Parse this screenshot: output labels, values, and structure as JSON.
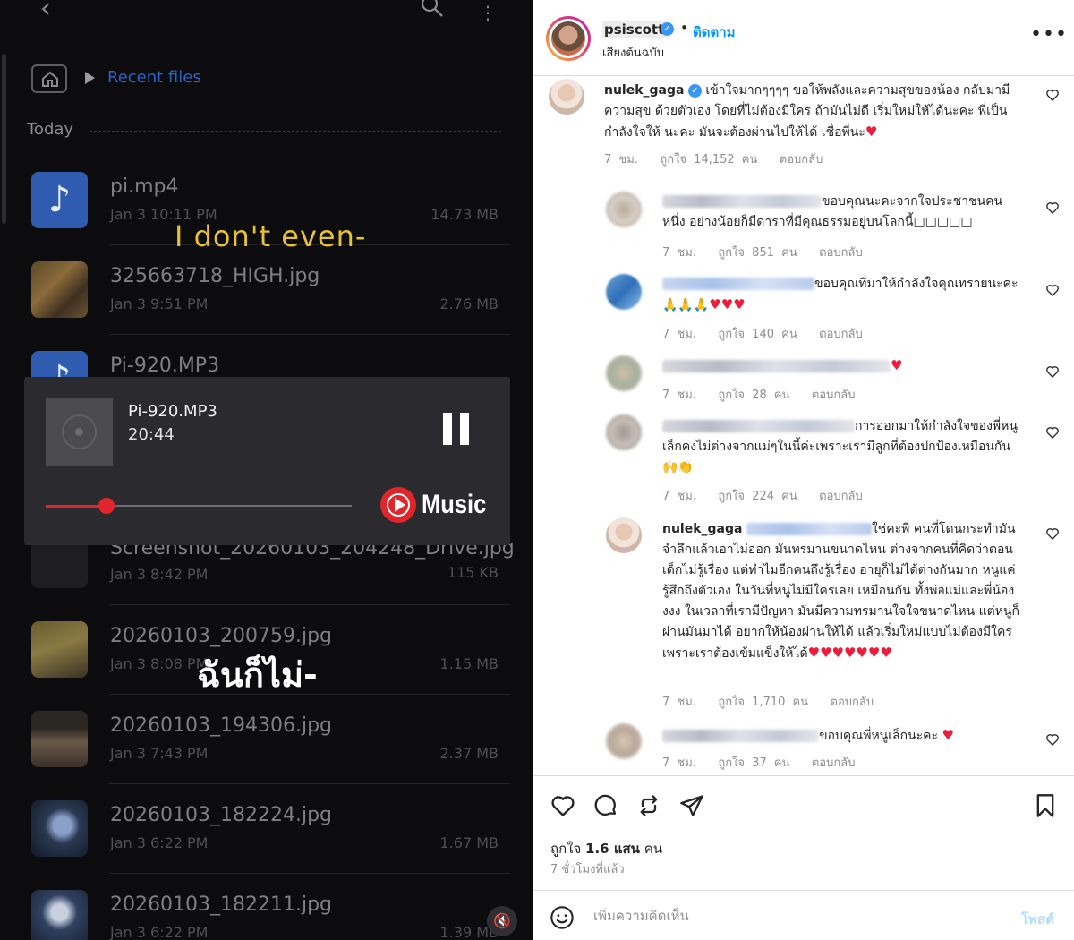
{
  "file_manager": {
    "breadcrumb": "Recent files",
    "section_label": "Today",
    "files": [
      {
        "name": "pi.mp4",
        "date": "Jan 3 10:11 PM",
        "size": "14.73 MB",
        "thumb": "music"
      },
      {
        "name": "325663718_HIGH.jpg",
        "date": "Jan 3 9:51 PM",
        "size": "2.76 MB",
        "thumb": "photo"
      },
      {
        "name": "Pi-920.MP3",
        "date": "",
        "size": "",
        "thumb": "music"
      },
      {
        "name": "Screenshot_20260103_204248_Drive.jpg",
        "date": "Jan 3 8:42 PM",
        "size": "115 KB",
        "thumb": "photo"
      },
      {
        "name": "20260103_200759.jpg",
        "date": "Jan 3 8:08 PM",
        "size": "1.15 MB",
        "thumb": "photo"
      },
      {
        "name": "20260103_194306.jpg",
        "date": "Jan 3 7:43 PM",
        "size": "2.37 MB",
        "thumb": "photo"
      },
      {
        "name": "20260103_182224.jpg",
        "date": "Jan 3 6:22 PM",
        "size": "1.67 MB",
        "thumb": "photo"
      },
      {
        "name": "20260103_182211.jpg",
        "date": "Jan 3 6:22 PM",
        "size": "1.39 MB",
        "thumb": "photo"
      }
    ]
  },
  "subtitles": {
    "english": "I don't even-",
    "thai": "ฉันก็ไม่-"
  },
  "player": {
    "title": "Pi-920.MP3",
    "time": "20:44",
    "progress": 0.2,
    "brand": "Music",
    "accent": "#e0262b"
  },
  "post": {
    "username": "psiscott",
    "follow": "ติดตาม",
    "audio": "เสียงต้นฉบับ",
    "likes_prefix": "ถูกใจ ",
    "likes_value": "1.6 แสน",
    "likes_suffix": " คน",
    "time": "7 ชั่วโมงที่แล้ว",
    "comment_placeholder": "เพิ่มความคิดเห็น",
    "post_button": "โพสต์"
  },
  "comments": [
    {
      "user": "nulek_gaga",
      "text": " เข้าใจมากๆๆๆๆ ขอให้พลังและความสุขของน้อง กลับมามีความสุข ด้วยตัวเอง โดยที่ไม่ต้องมีใคร ถ้ามันไม่ดี เริ่มใหม่ให้ได้นะคะ พี่เป็นกำลังใจให้ นะคะ มันจะต้องผ่านไปให้ได้ เชื่อพี่นะ",
      "hearts": "♥",
      "time": "7 ชม.",
      "likes": "ถูกใจ 14,152 คน",
      "reply": "ตอบกลับ"
    },
    {
      "user": "",
      "text": "ขอบคุณนะคะจากใจประชาชนคนหนึ่ง อย่างน้อยก็มีดาราที่มีคุณธรรมอยู่บนโลกนี้□□□□□",
      "hearts": "",
      "time": "7 ชม.",
      "likes": "ถูกใจ 851 คน",
      "reply": "ตอบกลับ"
    },
    {
      "user": "",
      "text": "ขอบคุณที่มาให้กำลังใจคุณทรายนะคะ🙏🙏🙏",
      "hearts": "♥♥♥",
      "time": "7 ชม.",
      "likes": "ถูกใจ 140 คน",
      "reply": "ตอบกลับ"
    },
    {
      "user": "",
      "text": "",
      "hearts": "♥",
      "time": "7 ชม.",
      "likes": "ถูกใจ 28 คน",
      "reply": "ตอบกลับ"
    },
    {
      "user": "",
      "text": "การออกมาให้กำลังใจของพี่หนูเล็กคงไม่ต่างจากแม่ๆในนี้ค่ะเพราะเรามีลูกที่ต้องปกป้องเหมือนกัน 🙌👏",
      "hearts": "",
      "time": "7 ชม.",
      "likes": "ถูกใจ 224 คน",
      "reply": "ตอบกลับ"
    },
    {
      "user": "nulek_gaga",
      "text": "ใช่คะพี่ คนที่โดนกระทำมันจำลึกแล้วเอาไม่ออก มันทรมานขนาดไหน ต่างจากคนที่คิดว่าตอนเด็กไม่รู้เรื่อง แต่ทำไมอีกคนถึงรู้เรื่อง อายุก็ไม่ได้ต่างกันมาก หนูแค่รู้สึกถึงตัวเอง ในวันที่หนูไม่มีใครเลย เหมือนกัน ทั้งพ่อแม่และพี่น้องงงง ในเวลาที่เรามีปัญหา มันมีความทรมานใจใจขนาดไหน แต่หนูก็ผ่านมันมาได้ อยากให้น้องผ่านให้ได้ แล้วเริ่มใหม่แบบไม่ต้องมีใคร เพราะเราต้องเข้มแข็งให้ได้",
      "hearts": "♥♥♥♥♥♥♥",
      "time": "7 ชม.",
      "likes": "ถูกใจ 1,710 คน",
      "reply": "ตอบกลับ"
    },
    {
      "user": "",
      "text": "ขอบคุณพี่หนูเล็กนะคะ",
      "hearts": "♥",
      "time": "7 ชม.",
      "likes": "ถูกใจ 37 คน",
      "reply": "ตอบกลับ"
    }
  ],
  "icons": {
    "back": "back-arrow-icon",
    "search": "search-icon",
    "more": "more-vertical-icon",
    "home": "home-icon",
    "like": "heart-icon",
    "comment": "comment-icon",
    "repost": "repost-icon",
    "share": "send-icon",
    "save": "bookmark-icon",
    "emoji": "emoji-icon",
    "mute": "mute-icon"
  }
}
